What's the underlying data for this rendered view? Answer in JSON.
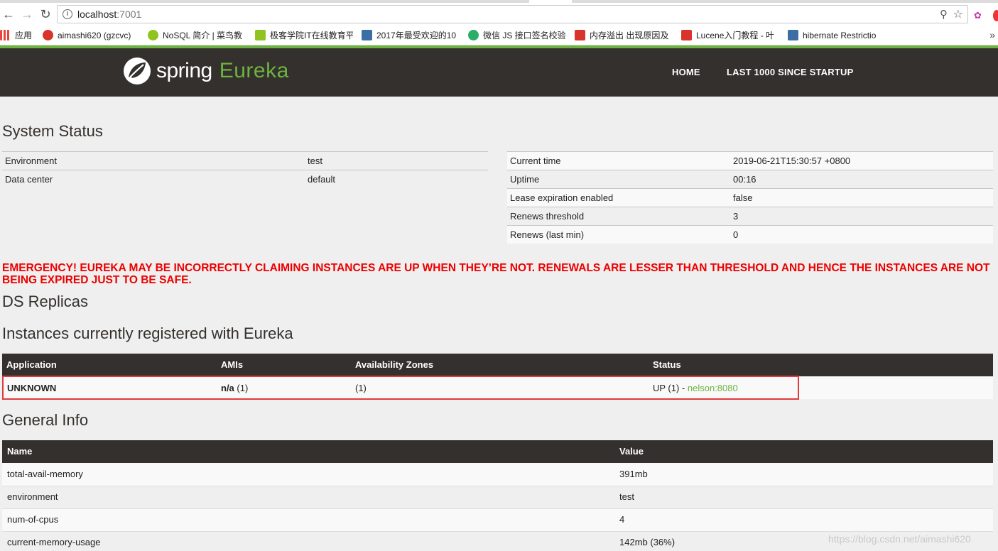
{
  "browser": {
    "url_host": "localhost",
    "url_port": ":7001",
    "bookmarks": [
      {
        "label": "应用",
        "color": "#e8453c"
      },
      {
        "label": "aimashi620 (gzcvc)",
        "color": "#d9342b"
      },
      {
        "label": "NoSQL 简介 | 菜鸟教",
        "color": "#8fc31f"
      },
      {
        "label": "极客学院IT在线教育平",
        "color": "#8fc31f"
      },
      {
        "label": "2017年最受欢迎的10",
        "color": "#3b6ea5"
      },
      {
        "label": "微信 JS 接口签名校验",
        "color": "#2aae67"
      },
      {
        "label": "内存溢出 出现原因及",
        "color": "#d9342b"
      },
      {
        "label": "Lucene入门教程 - 叶",
        "color": "#d9342b"
      },
      {
        "label": "hibernate Restrictio",
        "color": "#3b6ea5"
      }
    ],
    "more": "»"
  },
  "navbar": {
    "brand_word1": "spring",
    "brand_word2": "Eureka",
    "home": "HOME",
    "last1000": "LAST 1000 SINCE STARTUP"
  },
  "system_status": {
    "title": "System Status",
    "left": [
      {
        "key": "Environment",
        "value": "test"
      },
      {
        "key": "Data center",
        "value": "default"
      }
    ],
    "right": [
      {
        "key": "Current time",
        "value": "2019-06-21T15:30:57 +0800"
      },
      {
        "key": "Uptime",
        "value": "00:16"
      },
      {
        "key": "Lease expiration enabled",
        "value": "false"
      },
      {
        "key": "Renews threshold",
        "value": "3"
      },
      {
        "key": "Renews (last min)",
        "value": "0"
      }
    ]
  },
  "emergency": "EMERGENCY! EUREKA MAY BE INCORRECTLY CLAIMING INSTANCES ARE UP WHEN THEY’RE NOT. RENEWALS ARE LESSER THAN THRESHOLD AND HENCE THE INSTANCES ARE NOT BEING EXPIRED JUST TO BE SAFE.",
  "ds_replicas_title": "DS Replicas",
  "instances": {
    "title": "Instances currently registered with Eureka",
    "headers": [
      "Application",
      "AMIs",
      "Availability Zones",
      "Status"
    ],
    "rows": [
      {
        "application": "UNKNOWN",
        "ami_bold": "n/a",
        "ami_count": " (1)",
        "zones": "(1)",
        "status": "UP (1) - ",
        "instance_link": "nelson:8080"
      }
    ]
  },
  "general_info": {
    "title": "General Info",
    "headers": [
      "Name",
      "Value"
    ],
    "rows": [
      {
        "name": "total-avail-memory",
        "value": "391mb"
      },
      {
        "name": "environment",
        "value": "test"
      },
      {
        "name": "num-of-cpus",
        "value": "4"
      },
      {
        "name": "current-memory-usage",
        "value": "142mb (36%)"
      }
    ]
  },
  "watermark": "https://blog.csdn.net/aimashi620",
  "colors": {
    "brand_green": "#6db33f",
    "navbar": "#34302d",
    "emergency": "#ee0000",
    "highlight_box": "#e03b3b"
  }
}
